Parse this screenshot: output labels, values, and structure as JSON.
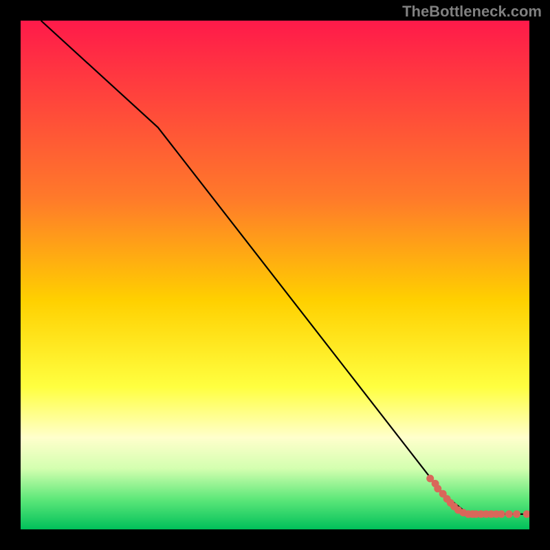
{
  "watermark": "TheBottleneck.com",
  "chart_data": {
    "type": "line",
    "title": "",
    "xlabel": "",
    "ylabel": "",
    "xlim": [
      0,
      100
    ],
    "ylim": [
      0,
      100
    ],
    "gradient_stops": [
      {
        "offset": 0,
        "color": "#ff1a4a"
      },
      {
        "offset": 35,
        "color": "#ff7a2a"
      },
      {
        "offset": 55,
        "color": "#ffd000"
      },
      {
        "offset": 72,
        "color": "#ffff40"
      },
      {
        "offset": 82,
        "color": "#ffffcc"
      },
      {
        "offset": 88,
        "color": "#d4ffb0"
      },
      {
        "offset": 94,
        "color": "#5fe87a"
      },
      {
        "offset": 100,
        "color": "#00c05a"
      }
    ],
    "series": [
      {
        "name": "curve",
        "type": "line",
        "color": "#000000",
        "points": [
          {
            "x": 4,
            "y": 100
          },
          {
            "x": 27,
            "y": 79
          },
          {
            "x": 83,
            "y": 7
          },
          {
            "x": 88,
            "y": 3
          },
          {
            "x": 100,
            "y": 3
          }
        ]
      },
      {
        "name": "markers",
        "type": "scatter",
        "color": "#d9675a",
        "points": [
          {
            "x": 80.5,
            "y": 10.0
          },
          {
            "x": 81.5,
            "y": 9.0
          },
          {
            "x": 82.0,
            "y": 8.0
          },
          {
            "x": 83.0,
            "y": 7.0
          },
          {
            "x": 83.8,
            "y": 6.0
          },
          {
            "x": 84.5,
            "y": 5.2
          },
          {
            "x": 85.2,
            "y": 4.5
          },
          {
            "x": 86.0,
            "y": 3.8
          },
          {
            "x": 87.0,
            "y": 3.3
          },
          {
            "x": 88.0,
            "y": 3.0
          },
          {
            "x": 88.8,
            "y": 3.0
          },
          {
            "x": 89.5,
            "y": 3.0
          },
          {
            "x": 90.5,
            "y": 3.0
          },
          {
            "x": 91.5,
            "y": 3.0
          },
          {
            "x": 92.5,
            "y": 3.0
          },
          {
            "x": 93.5,
            "y": 3.0
          },
          {
            "x": 94.5,
            "y": 3.0
          },
          {
            "x": 96.0,
            "y": 3.0
          },
          {
            "x": 97.5,
            "y": 3.0
          },
          {
            "x": 99.5,
            "y": 3.0
          }
        ]
      }
    ]
  }
}
